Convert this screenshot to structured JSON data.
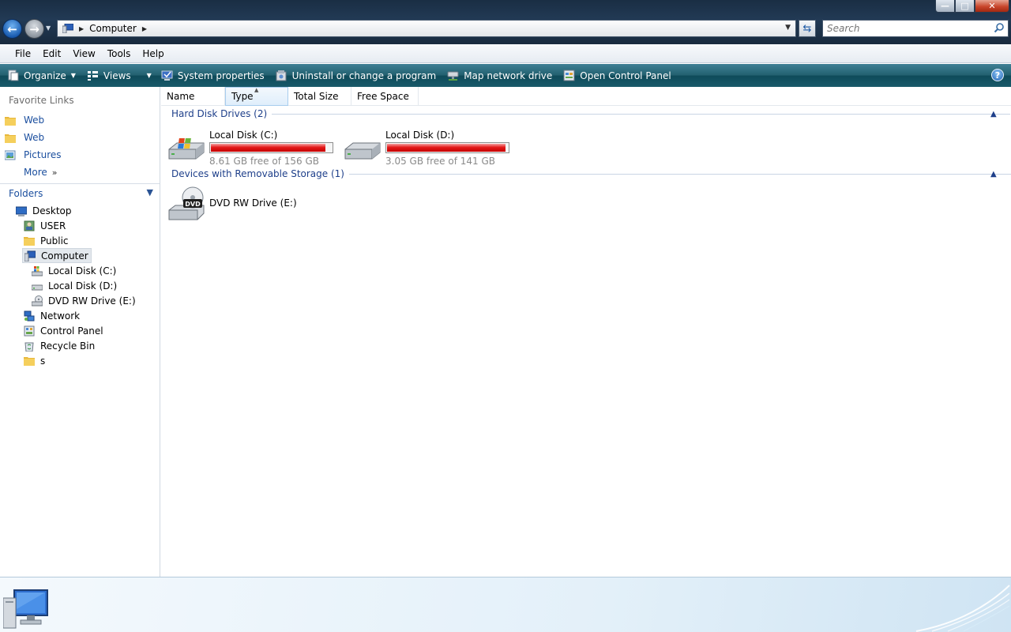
{
  "window": {
    "address": {
      "location": "Computer"
    },
    "search": {
      "placeholder": "Search"
    },
    "controls": {
      "minimize": "—",
      "maximize": "□",
      "close": "✕"
    }
  },
  "menu": {
    "items": [
      "File",
      "Edit",
      "View",
      "Tools",
      "Help"
    ]
  },
  "toolbar": {
    "organize": "Organize",
    "views": "Views",
    "system_properties": "System properties",
    "uninstall": "Uninstall or change a program",
    "map_drive": "Map network drive",
    "control_panel": "Open Control Panel",
    "help": "?"
  },
  "nav": {
    "favorites_title": "Favorite Links",
    "favorites": [
      "Web",
      "Web",
      "Pictures"
    ],
    "more": "More",
    "more_icon": "»",
    "folders_title": "Folders",
    "tree": [
      "Desktop",
      "USER",
      "Public",
      "Computer",
      "Local Disk (C:)",
      "Local Disk (D:)",
      "DVD RW Drive (E:)",
      "Network",
      "Control Panel",
      "Recycle Bin",
      "s"
    ]
  },
  "columns": [
    "Name",
    "Type",
    "Total Size",
    "Free Space"
  ],
  "groups": {
    "hard_disks": {
      "title": "Hard Disk Drives (2)",
      "drives": [
        {
          "name": "Local Disk (C:)",
          "free_text": "8.61 GB free of 156 GB",
          "used_fraction": 0.945
        },
        {
          "name": "Local Disk (D:)",
          "free_text": "3.05 GB free of 141 GB",
          "used_fraction": 0.978
        }
      ]
    },
    "removable": {
      "title": "Devices with Removable Storage (1)",
      "drives": [
        {
          "name": "DVD RW Drive (E:)",
          "badge": "DVD"
        }
      ]
    }
  },
  "colors": {
    "usage_bar": "#d40000",
    "toolbar": "#1f5b6b",
    "link": "#1a4e9e"
  }
}
